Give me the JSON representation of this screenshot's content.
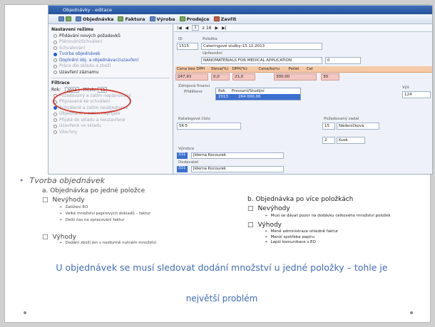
{
  "window": {
    "title": "Objednávky - editace"
  },
  "menubar": {
    "items": [
      "Objednávka",
      "Faktura",
      "Výroba",
      "Prodejce",
      "Zavřít"
    ]
  },
  "sidebar": {
    "section_mode": "Nastavení režimu",
    "mode_items": [
      {
        "label": "Přidávání nových požadavků",
        "state": "off"
      },
      {
        "label": "Plánování/Schválení",
        "state": "dim"
      },
      {
        "label": "Schvalování",
        "state": "dim"
      },
      {
        "label": "Tvorba objednávek",
        "state": "on"
      },
      {
        "label": "Doplnění obj. a objednávací/uzavření",
        "state": "blue"
      },
      {
        "label": "Práce dle skladu a zboží",
        "state": "dim"
      },
      {
        "label": "Uzavření záznamu",
        "state": "off"
      }
    ],
    "filter_title": "Filtrace",
    "year_label": "Rok:",
    "year_value": "2013",
    "month_label": "Měsíc:",
    "month_value": "11",
    "filter_items": [
      "Požadovaný a zatím neplánovaný",
      "Připravené ke schválení",
      "Schválené a zatím neobjednané",
      "Objednané a zatím nepřijaté",
      "Přijaté do skladu a neuzavřené",
      "Uzavřené ve skladu",
      "Všechny"
    ]
  },
  "main": {
    "toolbar": {
      "record": "1",
      "of": "z 16"
    },
    "id_label": "ID",
    "id_value": "1515",
    "polozka_label": "Položka",
    "polozka_value": "Cateringové služby-15.11.2013",
    "upresneni_label": "Upřesnění",
    "upresneni_value": "NANOMATERIALS FOR MEDICAL APPLICATION",
    "pocet_value": "0",
    "pricing_headers": [
      "Cena bez DPH",
      "Sleva(%)",
      "DPH(%)",
      "Cena/ks/ru",
      "Počet",
      "Cel"
    ],
    "pricing_values": [
      "247,93",
      "0,0",
      "21,0",
      "300,00",
      "30"
    ],
    "zdroj_label": "Zdrojová financi",
    "prideleno_label": "Přiděleno",
    "table_headers": [
      "Rok",
      "Provozní/Studijní"
    ],
    "table_values": [
      "2013",
      "264 000,00"
    ],
    "katalog_label": "Katalogové číslo",
    "katalog_value": "5K-5",
    "pozadovany_label": "Požadovaný zadal",
    "pozadovany_num": "15",
    "pozadovany_name": "Nádeníčková",
    "jednotka_num": "2",
    "jednotka_value": "Kusk",
    "vyrobce_label": "Výrobce",
    "vyrobce_num": "331",
    "vyrobce_value": "Jiderna Kocourek",
    "dodavatel_label": "Dodavatel",
    "dodavatel_num": "331",
    "dodavatel_value": "Jiderna Kocourek",
    "vys_label": "Výš",
    "vys_value": "124"
  },
  "slide": {
    "bullet": "Tvorba objednávek",
    "a": {
      "label": "a.  Objednávka po jedné položce",
      "nev": "Nevýhody",
      "items": [
        "Zatížení EO",
        "Velké množství papírových dokladů – faktur",
        "Delší čas na zpracování faktur"
      ],
      "vyh": "Výhody",
      "vyh_items": [
        "Dodání zboží jen v nezbytně nutném množství"
      ]
    },
    "b": {
      "label": "b. Objednávka po více položkách",
      "nev": "Nevýhody",
      "nev_items": [
        "Musí se dávat pozor na dodávku celkového množství položek"
      ],
      "vyh": "Výhody",
      "vyh_items": [
        "Méně administrace ohledně faktur",
        "Menší spotřeba papíru",
        "Lepší komunikace s EO"
      ]
    },
    "overlay_line1": "U objednávek se musí sledovat dodání množství u jedné položky – tohle je",
    "overlay_line2": "největší problém"
  }
}
